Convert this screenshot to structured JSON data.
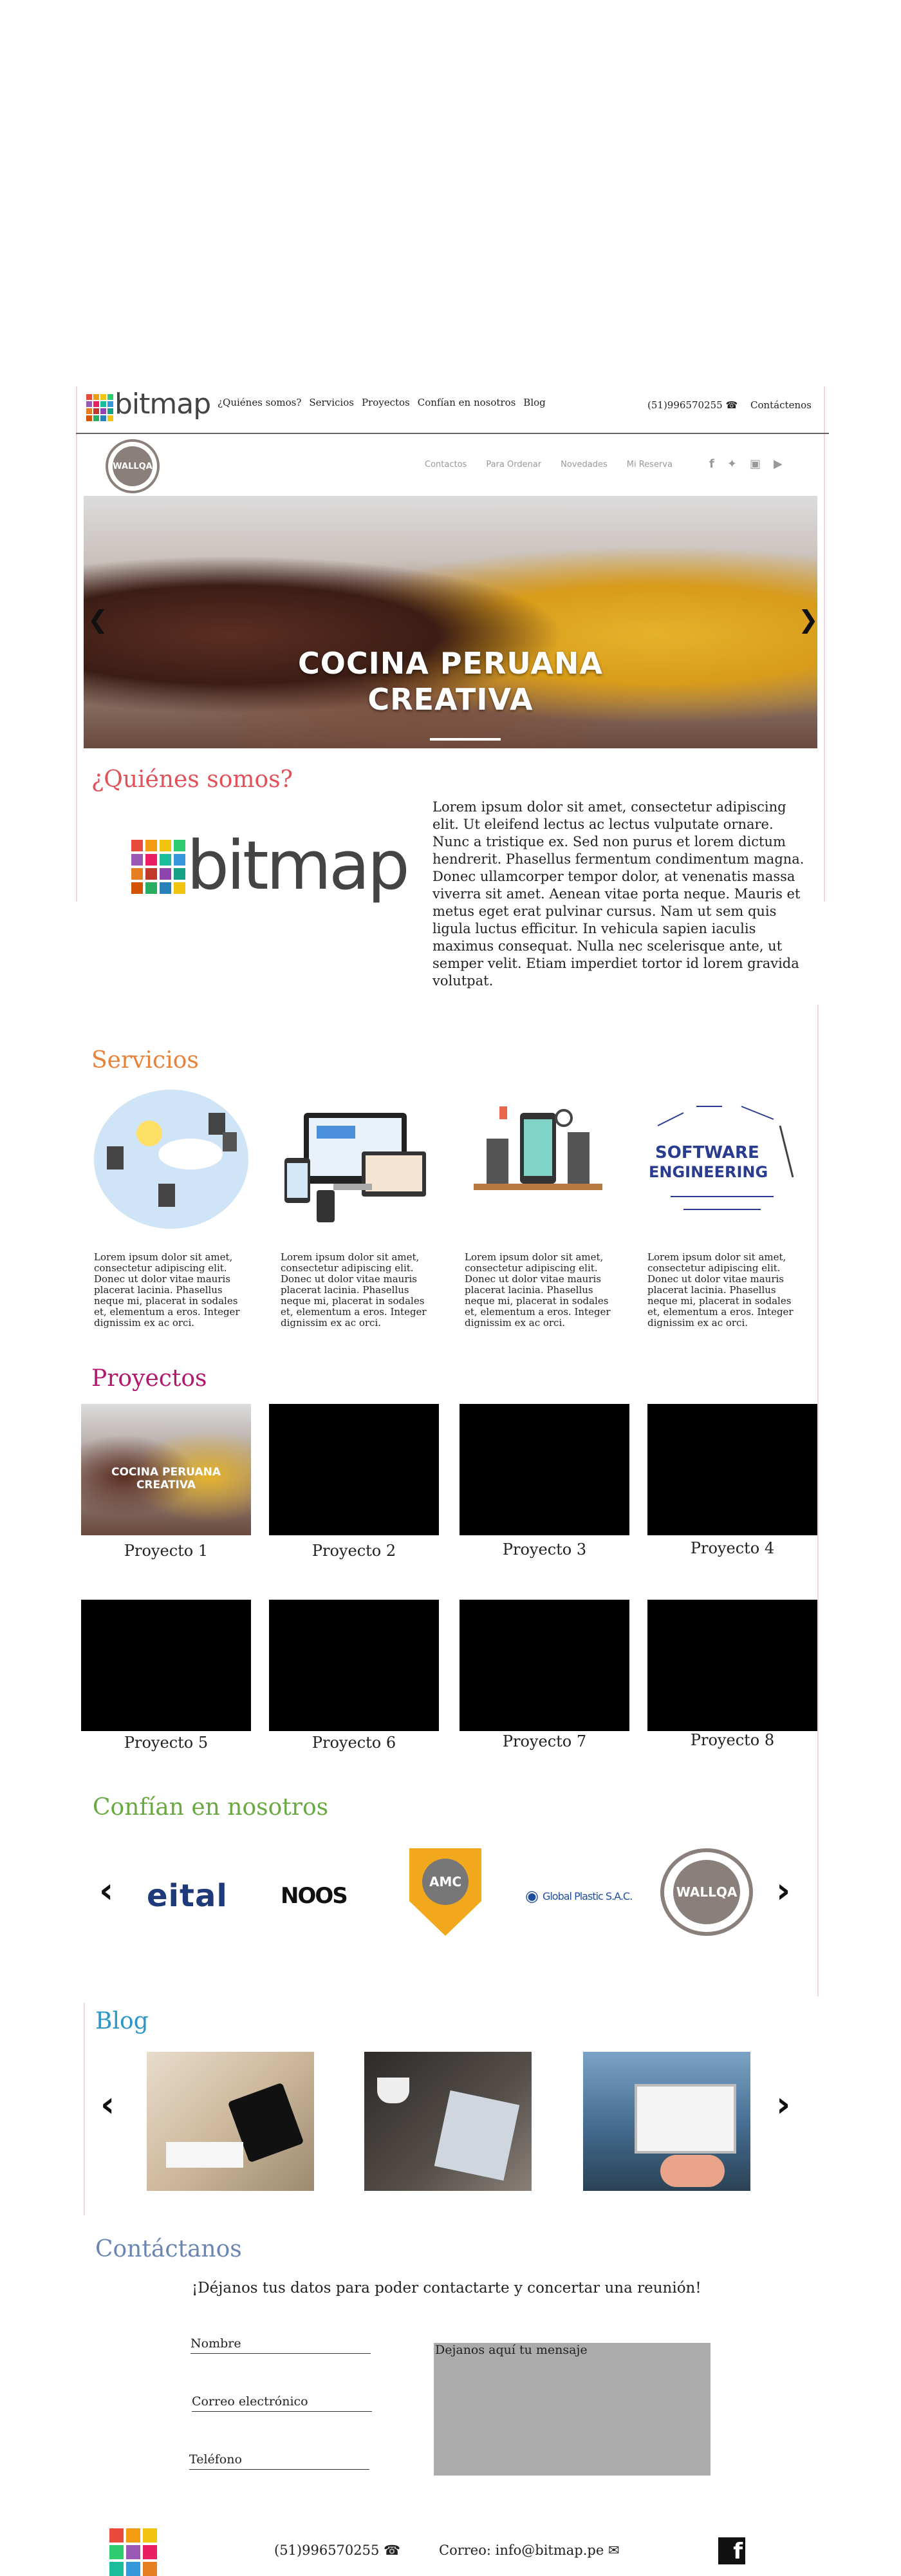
{
  "header": {
    "logo_text": "bitmap",
    "nav": [
      "¿Quiénes somos?",
      "Servicios",
      "Proyectos",
      "Confían en nosotros",
      "Blog"
    ],
    "phone": "(51)996570255",
    "contact": "Contáctenos"
  },
  "hero": {
    "logo_text": "WALLQA",
    "nav": [
      "Contactos",
      "Para Ordenar",
      "Novedades",
      "Mi Reserva"
    ],
    "title_line1": "COCINA PERUANA",
    "title_line2": "CREATIVA"
  },
  "about": {
    "title": "¿Quiénes somos?",
    "logo_text": "bitmap",
    "text": "Lorem ipsum dolor sit amet, consectetur adipiscing elit. Ut eleifend lectus ac lectus vulputate ornare. Nunc a tristique ex. Sed non purus et lorem dictum hendrerit. Phasellus fermentum condimentum magna. Donec ullamcorper tempor dolor, at venenatis massa viverra sit amet. Aenean vitae porta neque. Mauris et metus eget erat pulvinar cursus. Nam ut sem quis ligula luctus efficitur. In vehicula sapien iaculis maximus consequat. Nulla nec scelerisque ante, ut semper velit. Etiam imperdiet tortor id lorem gravida volutpat."
  },
  "services": {
    "title": "Servicios",
    "items": [
      {
        "text": "Lorem ipsum dolor sit amet, consectetur adipiscing elit. Donec ut dolor vitae mauris placerat lacinia. Phasellus neque mi, placerat in sodales et, elementum a eros. Integer dignissim ex ac orci."
      },
      {
        "text": "Lorem ipsum dolor sit amet, consectetur adipiscing elit. Donec ut dolor vitae mauris placerat lacinia. Phasellus neque mi, placerat in sodales et, elementum a eros. Integer dignissim ex ac orci."
      },
      {
        "text": "Lorem ipsum dolor sit amet, consectetur adipiscing elit. Donec ut dolor vitae mauris placerat lacinia. Phasellus neque mi, placerat in sodales et, elementum a eros. Integer dignissim ex ac orci."
      },
      {
        "text": "Lorem ipsum dolor sit amet, consectetur adipiscing elit. Donec ut dolor vitae mauris placerat lacinia. Phasellus neque mi, placerat in sodales et, elementum a eros. Integer dignissim ex ac orci."
      }
    ],
    "image_text_4": "SOFTWARE ENGINEERING"
  },
  "projects": {
    "title": "Proyectos",
    "items": [
      "Proyecto 1",
      "Proyecto 2",
      "Proyecto 3",
      "Proyecto 4",
      "Proyecto 5",
      "Proyecto 6",
      "Proyecto 7",
      "Proyecto 8"
    ],
    "thumb_line1": "COCINA PERUANA",
    "thumb_line2": "CREATIVA"
  },
  "clients": {
    "title": "Confían en nosotros",
    "logos": [
      "eital",
      "NOOS",
      "AMC",
      "Global Plastic S.A.C.",
      "WALLQA"
    ]
  },
  "blog": {
    "title": "Blog"
  },
  "contact": {
    "title": "Contáctanos",
    "intro": "¡Déjanos tus datos para poder contactarte y concertar una reunión!",
    "name_label": "Nombre",
    "email_label": "Correo electrónico",
    "phone_label": "Teléfono",
    "message_placeholder": "Dejanos aquí tu mensaje"
  },
  "footer": {
    "phone": "(51)996570255",
    "email": "Correo: info@bitmap.pe"
  },
  "colors": {
    "about_title": "#e0515a",
    "services_title": "#e8823a",
    "projects_title": "#b0196e",
    "clients_title": "#6aa842",
    "blog_title": "#2a97c9",
    "contact_title": "#6c86b4",
    "logo_squares": [
      "#e84b3c",
      "#f39c12",
      "#f1c40f",
      "#2ecc71",
      "#9b59b6",
      "#e91e63",
      "#1abc9c",
      "#3498db",
      "#e67e22",
      "#c0392b",
      "#8e44ad",
      "#16a085",
      "#d35400",
      "#27ae60",
      "#2980b9",
      "#f1c40f"
    ]
  },
  "icons": [
    "phone-icon",
    "facebook-icon",
    "twitter-icon",
    "instagram-icon",
    "youtube-icon",
    "chevron-left-icon",
    "chevron-right-icon",
    "envelope-icon"
  ]
}
